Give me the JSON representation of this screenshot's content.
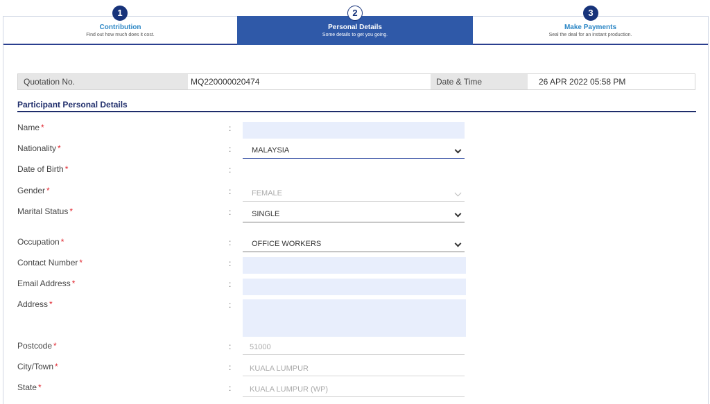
{
  "stepper": {
    "steps": [
      {
        "num": "1",
        "title": "Contribution",
        "subtitle": "Find out how much does it cost."
      },
      {
        "num": "2",
        "title": "Personal Details",
        "subtitle": "Some details to get you going."
      },
      {
        "num": "3",
        "title": "Make Payments",
        "subtitle": "Seal the deal for an instant production."
      }
    ]
  },
  "quotation": {
    "no_label": "Quotation No.",
    "no_value": "MQ220000020474",
    "date_label": "Date & Time",
    "date_value": "26 APR 2022 05:58 PM"
  },
  "section": {
    "title": "Participant Personal Details"
  },
  "form": {
    "colon": ":",
    "required_mark": "*",
    "name": {
      "label": "Name",
      "value": ""
    },
    "nationality": {
      "label": "Nationality",
      "value": "MALAYSIA"
    },
    "dob": {
      "label": "Date of Birth"
    },
    "gender": {
      "label": "Gender",
      "value": "FEMALE"
    },
    "marital": {
      "label": "Marital Status",
      "value": "SINGLE"
    },
    "occupation": {
      "label": "Occupation",
      "value": "OFFICE WORKERS"
    },
    "contact": {
      "label": "Contact Number",
      "value": ""
    },
    "email": {
      "label": "Email Address",
      "value": ""
    },
    "address": {
      "label": "Address",
      "value": ""
    },
    "postcode": {
      "label": "Postcode",
      "value": "51000"
    },
    "city": {
      "label": "City/Town",
      "value": "KUALA LUMPUR"
    },
    "state": {
      "label": "State",
      "value": "KUALA LUMPUR (WP)"
    }
  },
  "colors": {
    "primary": "#2f59a8",
    "dark": "#17337a",
    "required": "#e0262f",
    "input_bg": "#e8eefc"
  }
}
